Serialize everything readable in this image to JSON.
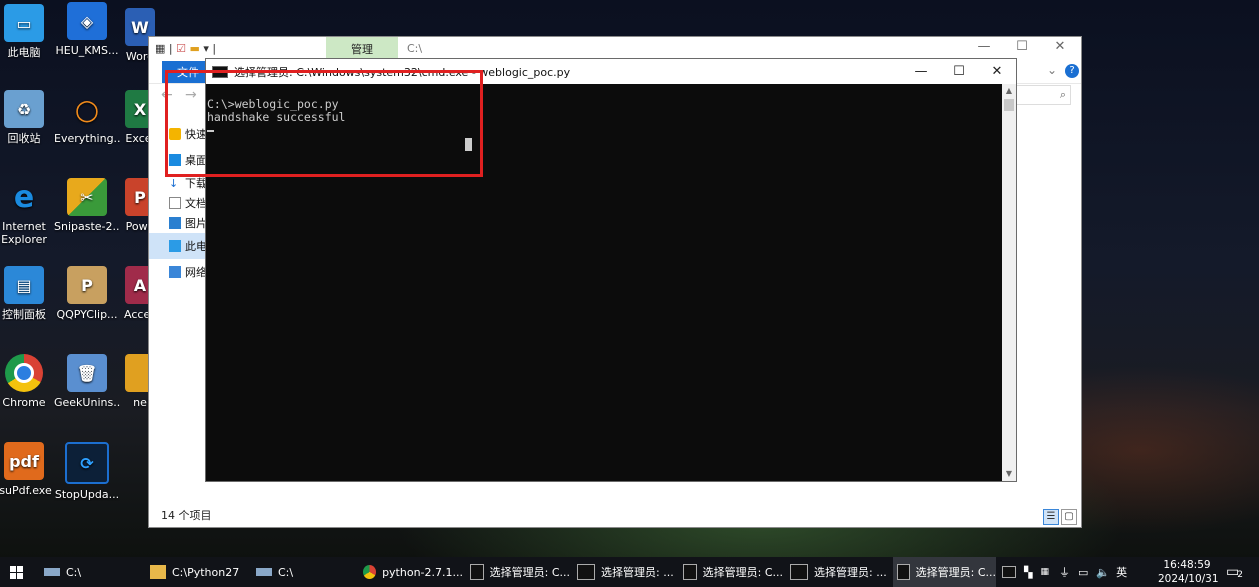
{
  "desktop": {
    "icons": [
      {
        "label": "此电脑",
        "color": "#2b9be6"
      },
      {
        "label": "HEU_KMS...",
        "color": "#1f6fd8"
      },
      {
        "label": "Word",
        "color": "#2b5fb4"
      },
      {
        "label": "回收站",
        "color": "#6aa0d0"
      },
      {
        "label": "Everything...",
        "color": "#f28c1c"
      },
      {
        "label": "Excel",
        "color": "#1f7a43"
      },
      {
        "label": "Internet Explorer",
        "color": "#1a8be0"
      },
      {
        "label": "Snipaste-2...",
        "color": "#e8a91c"
      },
      {
        "label": "Powe",
        "color": "#c9432b"
      },
      {
        "label": "控制面板",
        "color": "#2b88d8"
      },
      {
        "label": "QQPYClip...",
        "color": "#c8a060"
      },
      {
        "label": "Acces",
        "color": "#a02b4a"
      },
      {
        "label": "Chrome",
        "color": "#d94234"
      },
      {
        "label": "GeekUnins...",
        "color": "#5a8fd0"
      },
      {
        "label": "ne",
        "color": "#e0a020"
      },
      {
        "label": "isuPdf.exe",
        "color": "#e06a1c"
      },
      {
        "label": "StopUpda...",
        "color": "#1c6fd0"
      }
    ]
  },
  "explorer": {
    "manage_tab": "管理",
    "path": "C:\\",
    "file_tab": "文件",
    "search_icon": "⌕",
    "sidebar": [
      "快速",
      "桌面",
      "下载",
      "文档",
      "图片",
      "此电",
      "网络"
    ],
    "status": "14 个项目"
  },
  "cmd": {
    "title": "选择管理员: C:\\Windows\\system32\\cmd.exe - weblogic_poc.py",
    "lines": [
      "C:\\>weblogic_poc.py",
      "handshake successful"
    ],
    "btn_min": "—",
    "btn_max": "☐",
    "btn_close": "✕"
  },
  "taskbar": {
    "items": [
      {
        "label": "C:\\",
        "type": "drive"
      },
      {
        "label": "C:\\Python27",
        "type": "folder"
      },
      {
        "label": "C:\\",
        "type": "drive"
      },
      {
        "label": "python-2.7.1...",
        "type": "chrome"
      },
      {
        "label": "选择管理员: C...",
        "type": "cmd"
      },
      {
        "label": "选择管理员: ...",
        "type": "cmd"
      },
      {
        "label": "选择管理员: C...",
        "type": "cmd"
      },
      {
        "label": "选择管理员: ...",
        "type": "cmd"
      },
      {
        "label": "选择管理员: C...",
        "type": "cmd"
      }
    ],
    "ime": "英",
    "time": "16:48:59",
    "date": "2024/10/31",
    "notification_count": "2"
  }
}
